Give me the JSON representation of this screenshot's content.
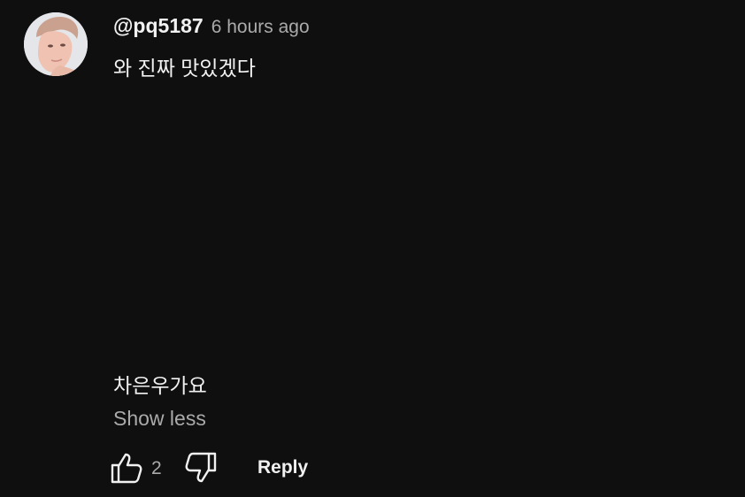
{
  "comment": {
    "author": "@pq5187",
    "timestamp": "6 hours ago",
    "text_line_1": "와 진짜 맛있겠다",
    "text_line_2": "차은우가요",
    "show_less_label": "Show less",
    "like_count": "2",
    "reply_label": "Reply"
  },
  "icons": {
    "like": "thumbs-up-icon",
    "dislike": "thumbs-down-icon"
  },
  "colors": {
    "background": "#0f0f0f",
    "primary_text": "#f1f1f1",
    "secondary_text": "#aaaaaa"
  }
}
